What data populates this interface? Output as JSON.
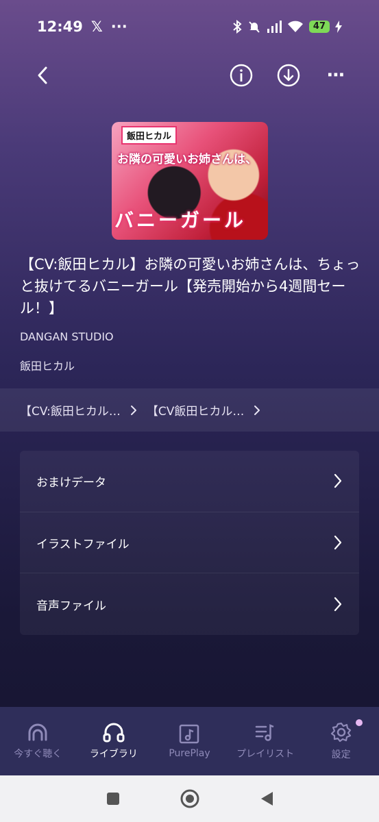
{
  "status": {
    "time": "12:49",
    "x_glyph": "𝕏",
    "more": "···",
    "battery": "47"
  },
  "nav": {
    "back_icon": "chevron-left-icon",
    "info_icon": "info-icon",
    "download_icon": "download-icon",
    "more_label": "⋯"
  },
  "cover": {
    "badge": "飯田ヒカル",
    "title_line1": "お隣の可愛いお姉さんは、",
    "title_line2": "バニーガール"
  },
  "work": {
    "title": "【CV:飯田ヒカル】お隣の可愛いお姉さんは、ちょっと抜けてるバニーガール【発売開始から4週間セール！】",
    "circle": "DANGAN STUDIO",
    "cv": "飯田ヒカル"
  },
  "series": [
    {
      "label": "【CV:飯田ヒカル…"
    },
    {
      "label": "【CV飯田ヒカル…"
    }
  ],
  "folders": [
    {
      "label": "おまけデータ"
    },
    {
      "label": "イラストファイル"
    },
    {
      "label": "音声ファイル"
    }
  ],
  "tabs": [
    {
      "label": "今すぐ聴く",
      "icon": "headphone-arc-icon"
    },
    {
      "label": "ライブラリ",
      "icon": "headphones-icon"
    },
    {
      "label": "PurePlay",
      "icon": "music-file-icon"
    },
    {
      "label": "プレイリスト",
      "icon": "playlist-icon"
    },
    {
      "label": "設定",
      "icon": "gear-icon"
    }
  ],
  "colors": {
    "accent_active": "#ffffff",
    "inactive": "#8f8ab8",
    "bottom_nav_bg": "#2f2e5a",
    "badge_dot": "#e6b8f2"
  }
}
